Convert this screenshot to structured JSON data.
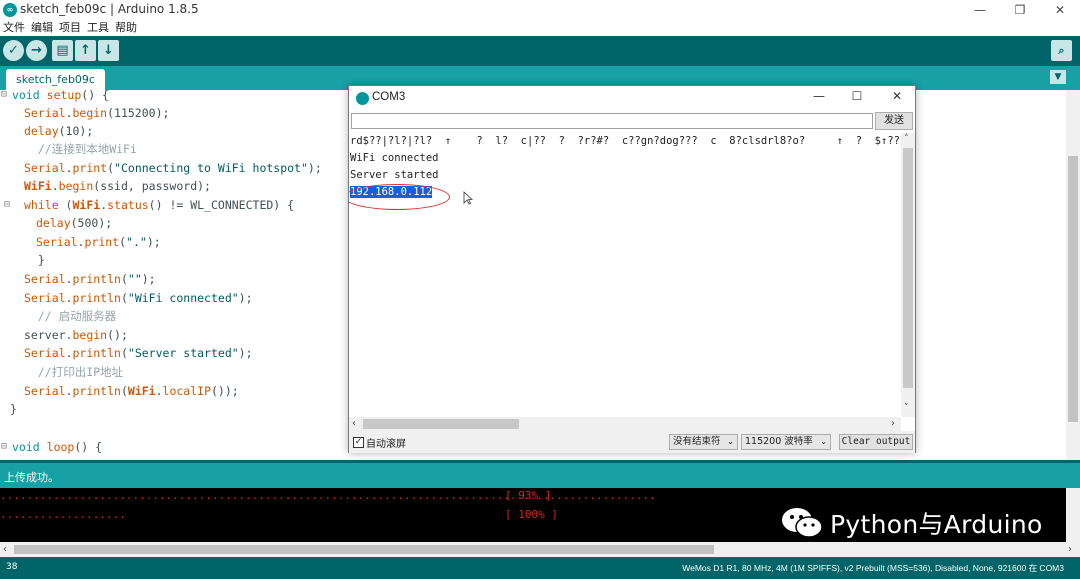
{
  "window": {
    "title": "sketch_feb09c | Arduino 1.8.5",
    "minimize": "—",
    "restore": "❐",
    "close": "✕"
  },
  "menu": [
    "文件",
    "编辑",
    "项目",
    "工具",
    "帮助"
  ],
  "toolbar": {
    "verify_icon": "✓",
    "upload_icon": "→",
    "new_icon": "▤",
    "open_icon": "↑",
    "save_icon": "↓",
    "serial_monitor_icon": "⌕"
  },
  "tab": {
    "name": "sketch_feb09c",
    "menu_icon": "▼"
  },
  "editor": {
    "lines": [
      "void setup() {",
      "  Serial.begin(115200);",
      "  delay(10);",
      "  //连接到本地WiFi",
      "  Serial.print(\"Connecting to WiFi hotspot\");",
      "  WiFi.begin(ssid, password);",
      "  while (WiFi.status() != WL_CONNECTED) {",
      "    delay(500);",
      "    Serial.print(\".\");",
      "  }",
      "  Serial.println(\"\");",
      "  Serial.println(\"WiFi connected\");",
      "  // 启动服务器",
      "  server.begin();",
      "  Serial.println(\"Server started\");",
      "  //打印出IP地址",
      "  Serial.println(WiFi.localIP());",
      "}",
      "",
      "void loop() {"
    ],
    "fold_marker": "⊟"
  },
  "status": {
    "message": "上传成功。"
  },
  "console": {
    "line1_dots": "...................................................................................................",
    "line1_progress": "[ 93% ]",
    "line2_dots": "...................",
    "line2_progress": "[ 100% ]"
  },
  "bottom": {
    "line_number": "38",
    "board_info": "WeMos D1 R1, 80 MHz, 4M (1M SPIFFS), v2 Prebuilt (MSS=536), Disabled, None, 921600 在 COM3"
  },
  "watermark": {
    "text": "Python与Arduino"
  },
  "serial_monitor": {
    "title": "COM3",
    "send_button": "发送",
    "send_input_value": "",
    "output_lines": [
      "rd$??|?l?|?l?  ↑    ?  l?  c|??  ?  ?r?#?  c??gn?dog???  c  8?clsdrl8?o?     ↑  ?  $↑??    ↑b",
      "WiFi connected",
      "Server started",
      "192.168.0.112"
    ],
    "autoscroll_label": "自动滚屏",
    "autoscroll_checked": "✓",
    "line_ending": "没有结束符",
    "baud_rate": "115200 波特率",
    "clear_button": "Clear output",
    "minimize": "—",
    "maximize": "☐",
    "close": "✕"
  }
}
